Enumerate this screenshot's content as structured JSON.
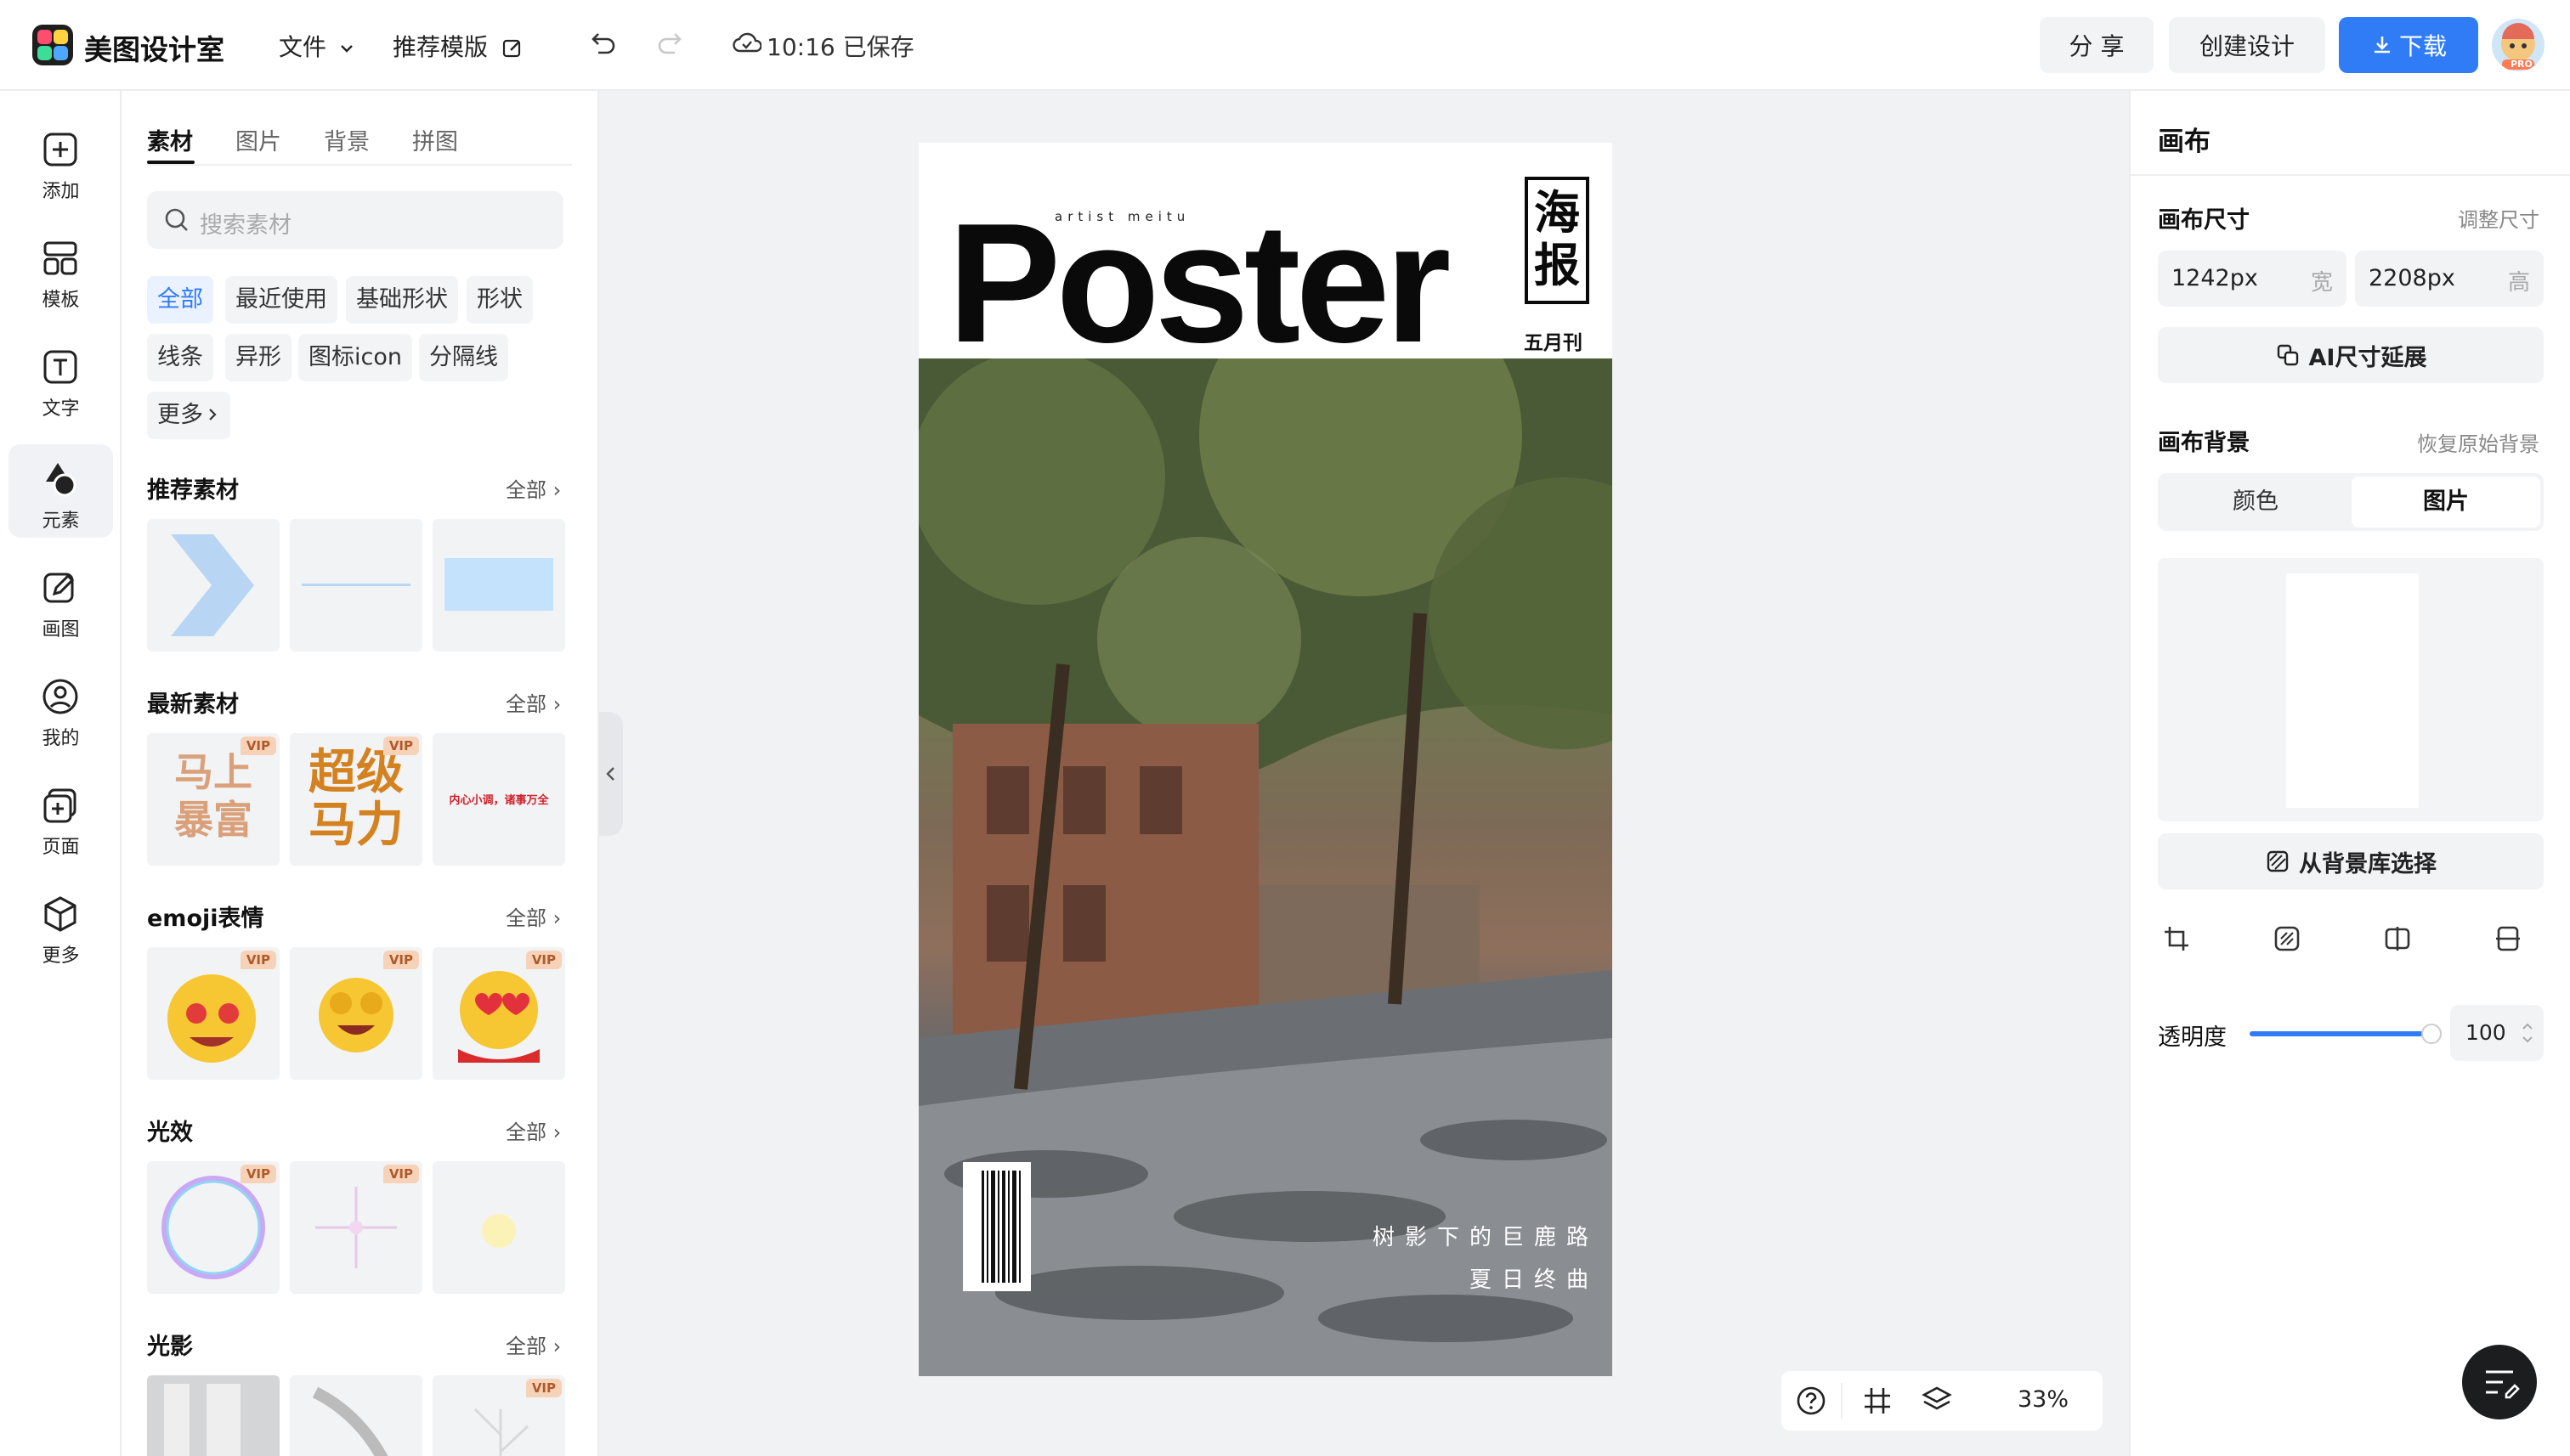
{
  "app": {
    "name": "美图设计室"
  },
  "topbar": {
    "file_menu": "文件",
    "template_menu": "推荐模版",
    "save_status": "10:16 已保存",
    "share": "分 享",
    "create": "创建设计",
    "download": "下载",
    "avatar_badge": "PRO"
  },
  "iconbar": {
    "items": [
      {
        "label": "添加",
        "icon": "plus-square-icon"
      },
      {
        "label": "模板",
        "icon": "template-icon"
      },
      {
        "label": "文字",
        "icon": "text-icon"
      },
      {
        "label": "元素",
        "icon": "shapes-icon"
      },
      {
        "label": "画图",
        "icon": "pencil-icon"
      },
      {
        "label": "我的",
        "icon": "user-icon"
      },
      {
        "label": "页面",
        "icon": "page-add-icon"
      },
      {
        "label": "更多",
        "icon": "cube-icon"
      }
    ],
    "active_index": 3
  },
  "left_panel": {
    "tabs": [
      "素材",
      "图片",
      "背景",
      "拼图"
    ],
    "active_tab": 0,
    "search_placeholder": "搜索素材",
    "chips": [
      "全部",
      "最近使用",
      "基础形状",
      "形状",
      "线条",
      "异形",
      "图标icon",
      "分隔线",
      "更多"
    ],
    "active_chip": 0,
    "all_label": "全部",
    "vip_label": "VIP",
    "sections": [
      {
        "title": "推荐素材"
      },
      {
        "title": "最新素材",
        "tile_texts": [
          "马上暴富",
          "超级马力",
          "内心小调，诸事万全"
        ]
      },
      {
        "title": "emoji表情"
      },
      {
        "title": "光效"
      },
      {
        "title": "光影"
      }
    ]
  },
  "canvas": {
    "artist_text": "artist meitu",
    "poster_word": "Poster",
    "side_title": "海报",
    "issue": "五月刊",
    "subtitle_line1": "树影下的巨鹿路",
    "subtitle_line2": "夏日终曲"
  },
  "zoombar": {
    "zoom": "33%"
  },
  "right_panel": {
    "title": "画布",
    "size_label": "画布尺寸",
    "resize_link": "调整尺寸",
    "width_value": "1242px",
    "width_unit": "宽",
    "height_value": "2208px",
    "height_unit": "高",
    "ai_extend": "AI尺寸延展",
    "bg_label": "画布背景",
    "restore_link": "恢复原始背景",
    "seg_color": "颜色",
    "seg_image": "图片",
    "from_library": "从背景库选择",
    "opacity_label": "透明度",
    "opacity_value": "100",
    "opacity_level_percent": 100
  },
  "colors": {
    "accent": "#2f7cf6",
    "vip_bg": "#f6d2b8"
  }
}
